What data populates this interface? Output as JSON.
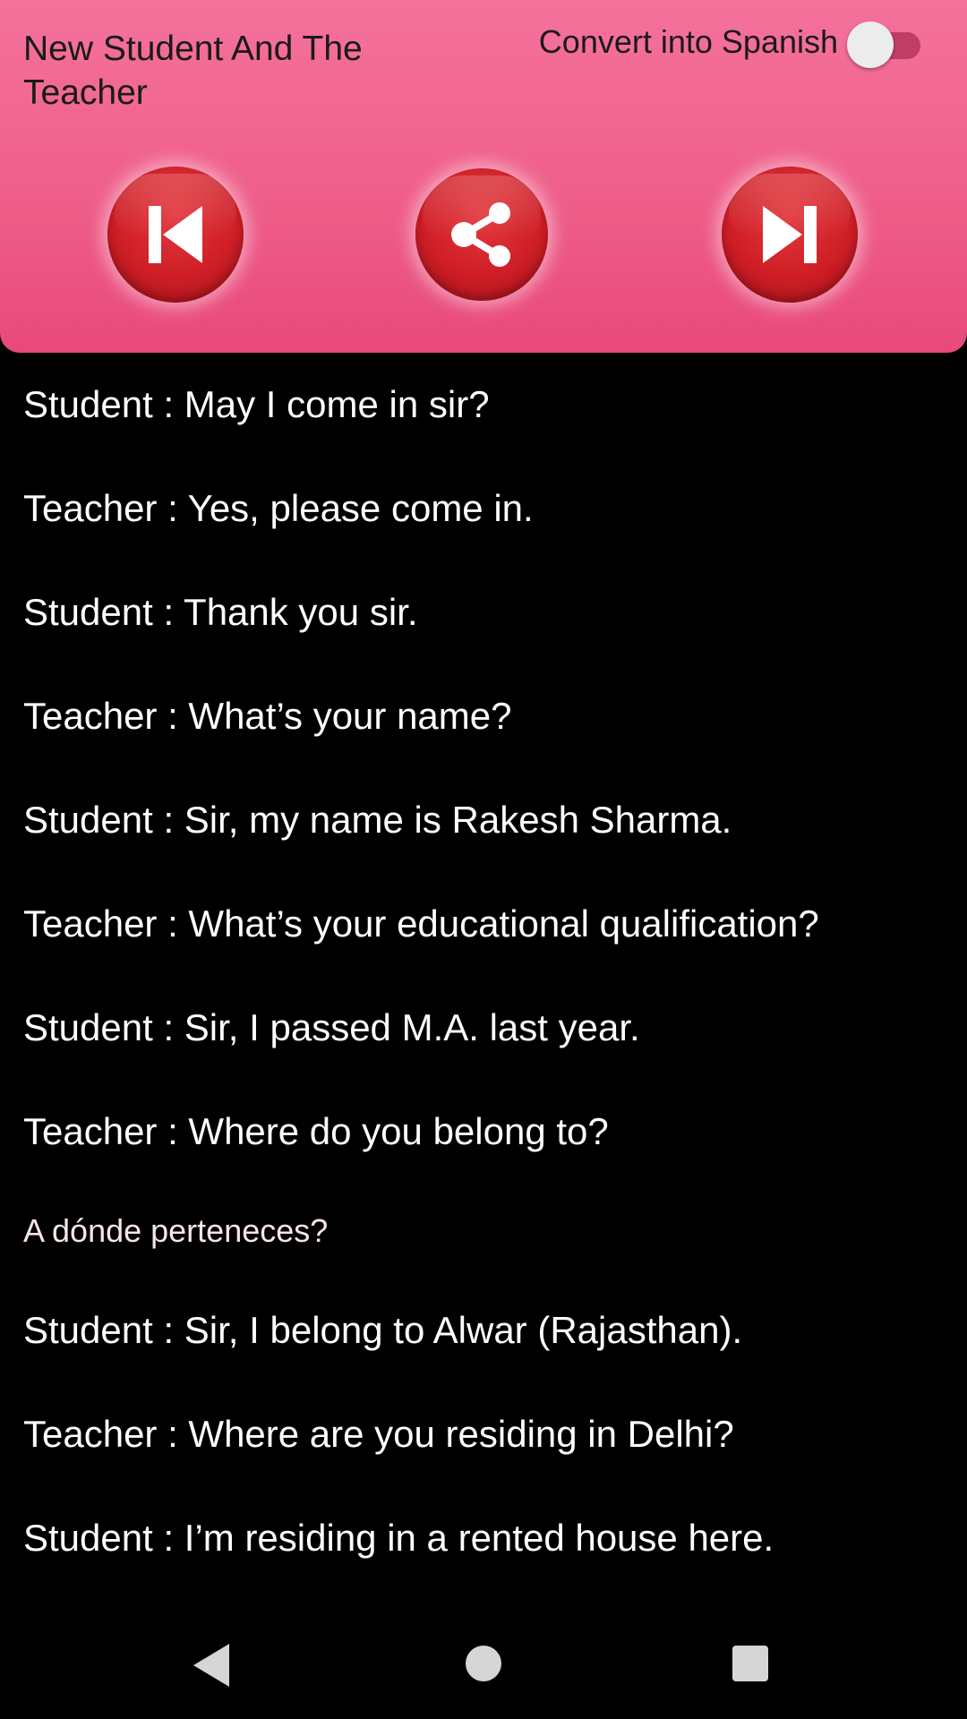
{
  "header": {
    "title": "New Student And The Teacher",
    "toggle_label": "Convert into Spanish",
    "toggle_on": false,
    "accent_color": "#ef5f8a",
    "button_color": "#cf1e26"
  },
  "controls": {
    "prev_icon": "skip-previous-icon",
    "share_icon": "share-icon",
    "next_icon": "skip-next-icon"
  },
  "dialogue": [
    {
      "text": "Student : May I come in sir?"
    },
    {
      "text": "Teacher : Yes, please come in."
    },
    {
      "text": "Student : Thank you sir."
    },
    {
      "text": "Teacher : What’s your name?"
    },
    {
      "text": "Student : Sir,  my name is Rakesh Sharma."
    },
    {
      "text": "Teacher : What’s your educational qualification?"
    },
    {
      "text": "Student : Sir, I passed M.A. last year."
    },
    {
      "text": "Teacher : Where do you belong to?"
    },
    {
      "text": "A dónde perteneces?"
    },
    {
      "text": "Student : Sir, I belong to Alwar (Rajasthan)."
    },
    {
      "text": "Teacher : Where are you residing in Delhi?"
    },
    {
      "text": "Student : I’m residing in a rented house here."
    }
  ],
  "navbar": {
    "back_icon": "back-triangle-icon",
    "home_icon": "home-circle-icon",
    "recents_icon": "recents-square-icon"
  }
}
